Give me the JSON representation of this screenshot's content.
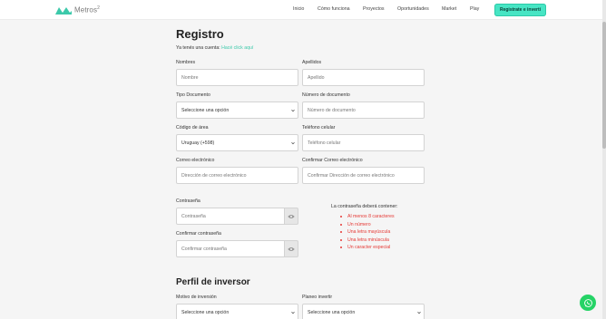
{
  "header": {
    "brand": "Metros",
    "brand_sup": "2",
    "nav": [
      "Inicio",
      "Cómo funciona",
      "Proyectos",
      "Oportunidades",
      "Market",
      "Play"
    ],
    "cta": "Registrate e invertí"
  },
  "form": {
    "title": "Registro",
    "login_prompt": "Ya tenés una cuenta:",
    "login_link": "Hacé click aquí",
    "nombres": {
      "label": "Nombres",
      "placeholder": "Nombre"
    },
    "apellidos": {
      "label": "Apellidos",
      "placeholder": "Apellido"
    },
    "tipo_documento": {
      "label": "Tipo Documento",
      "value": "Seleccione una opción"
    },
    "numero_documento": {
      "label": "Número de documento",
      "placeholder": "Número de documento"
    },
    "codigo_area": {
      "label": "Código de área",
      "value": "Uruguay (+598)"
    },
    "telefono": {
      "label": "Teléfono celular",
      "placeholder": "Teléfono celular"
    },
    "correo": {
      "label": "Correo electrónico",
      "placeholder": "Dirección de correo electrónico"
    },
    "confirmar_correo": {
      "label": "Confirmar Correo electrónico",
      "placeholder": "Confirmar Dirección de correo electrónico"
    },
    "contrasena": {
      "label": "Contraseña",
      "placeholder": "Contraseña"
    },
    "confirmar_contrasena": {
      "label": "Confirmar contraseña",
      "placeholder": "Confirmar contraseña"
    },
    "password_rules": {
      "title": "La contraseña deberá contener:",
      "items": [
        "Al menos 8 caracteres",
        "Un número",
        "Una letra mayúscula",
        "Una letra minúscula",
        "Un caracter especial"
      ],
      "color": "#e53935"
    }
  },
  "investor": {
    "title": "Perfil de inversor",
    "motivo": {
      "label": "Motivo de inversión",
      "value": "Seleccione una opción"
    },
    "planeo": {
      "label": "Planeo invertir",
      "value": "Seleccione una opción"
    }
  },
  "colors": {
    "accent": "#47e5c4",
    "link": "#3cc9aa",
    "whatsapp": "#25d366"
  },
  "icons": {
    "logo": "metros-logo-icon",
    "eye": "eye-icon",
    "chevron": "chevron-down-icon",
    "whatsapp": "whatsapp-icon"
  }
}
